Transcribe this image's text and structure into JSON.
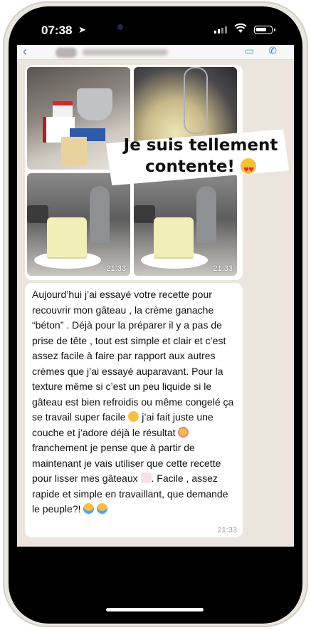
{
  "status_bar": {
    "time": "07:38",
    "location_icon": "location-arrow-icon",
    "signal": "signal-icon",
    "wifi": "wifi-icon",
    "battery": "battery-icon",
    "battery_level": 0.6
  },
  "chat_header": {
    "back_icon": "chevron-left-icon",
    "video_icon": "video-call-icon",
    "call_icon": "phone-icon"
  },
  "images_bubble": {
    "photos": [
      "ingredients-photo",
      "whisked-cream-photo",
      "cake-mixer-photo-1",
      "cake-mixer-photo-2"
    ],
    "timestamp_1": "21:33",
    "timestamp_2": "21:33"
  },
  "sticker": {
    "line1": "Je suis tellement",
    "line2": "contente!",
    "emoji": "heart-eyes-emoji"
  },
  "message": {
    "segments": {
      "a": "Aujourd’hui j’ai essayé votre recette pour recouvrir mon gâteau , la crème ganache “béton” . Déjà pour la préparer il y a pas de prise de tête , tout est simple et clair et c’est assez facile à faire par rapport aux autres crèmes que j’ai essayé auparavant. Pour la texture même si c’est un peu liquide si le gâteau est bien refroidis ou même congelé ça se travail super facile ",
      "b": " j’ai fait juste une couche et j’adore déjà le résultat ",
      "c": " franchement je pense que à partir de maintenant je vais utiliser que cette recette pour lisser mes gâteaux ",
      "d": ". Facile , assez rapide et simple en travaillant, que demande le peuple?! "
    },
    "time": "21:33"
  }
}
